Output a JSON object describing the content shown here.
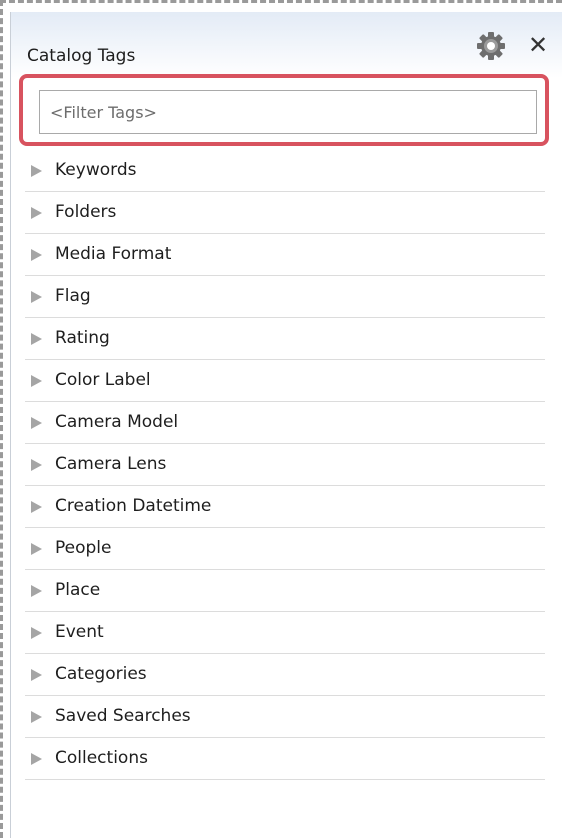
{
  "panel": {
    "title": "Catalog Tags",
    "settings_icon": "gear-icon",
    "close_icon": "close-icon",
    "close_glyph": "✕"
  },
  "filter": {
    "placeholder": "<Filter Tags>",
    "value": ""
  },
  "highlight_color": "#d8535f",
  "tags": [
    {
      "label": "Keywords",
      "icon": "expand-arrow-icon"
    },
    {
      "label": "Folders",
      "icon": "expand-arrow-icon"
    },
    {
      "label": "Media Format",
      "icon": "expand-arrow-icon"
    },
    {
      "label": "Flag",
      "icon": "expand-arrow-icon"
    },
    {
      "label": "Rating",
      "icon": "expand-arrow-icon"
    },
    {
      "label": "Color Label",
      "icon": "expand-arrow-icon"
    },
    {
      "label": "Camera Model",
      "icon": "expand-arrow-icon"
    },
    {
      "label": "Camera Lens",
      "icon": "expand-arrow-icon"
    },
    {
      "label": "Creation Datetime",
      "icon": "expand-arrow-icon"
    },
    {
      "label": "People",
      "icon": "expand-arrow-icon"
    },
    {
      "label": "Place",
      "icon": "expand-arrow-icon"
    },
    {
      "label": "Event",
      "icon": "expand-arrow-icon"
    },
    {
      "label": "Categories",
      "icon": "expand-arrow-icon"
    },
    {
      "label": "Saved Searches",
      "icon": "expand-arrow-icon"
    },
    {
      "label": "Collections",
      "icon": "expand-arrow-icon"
    }
  ]
}
